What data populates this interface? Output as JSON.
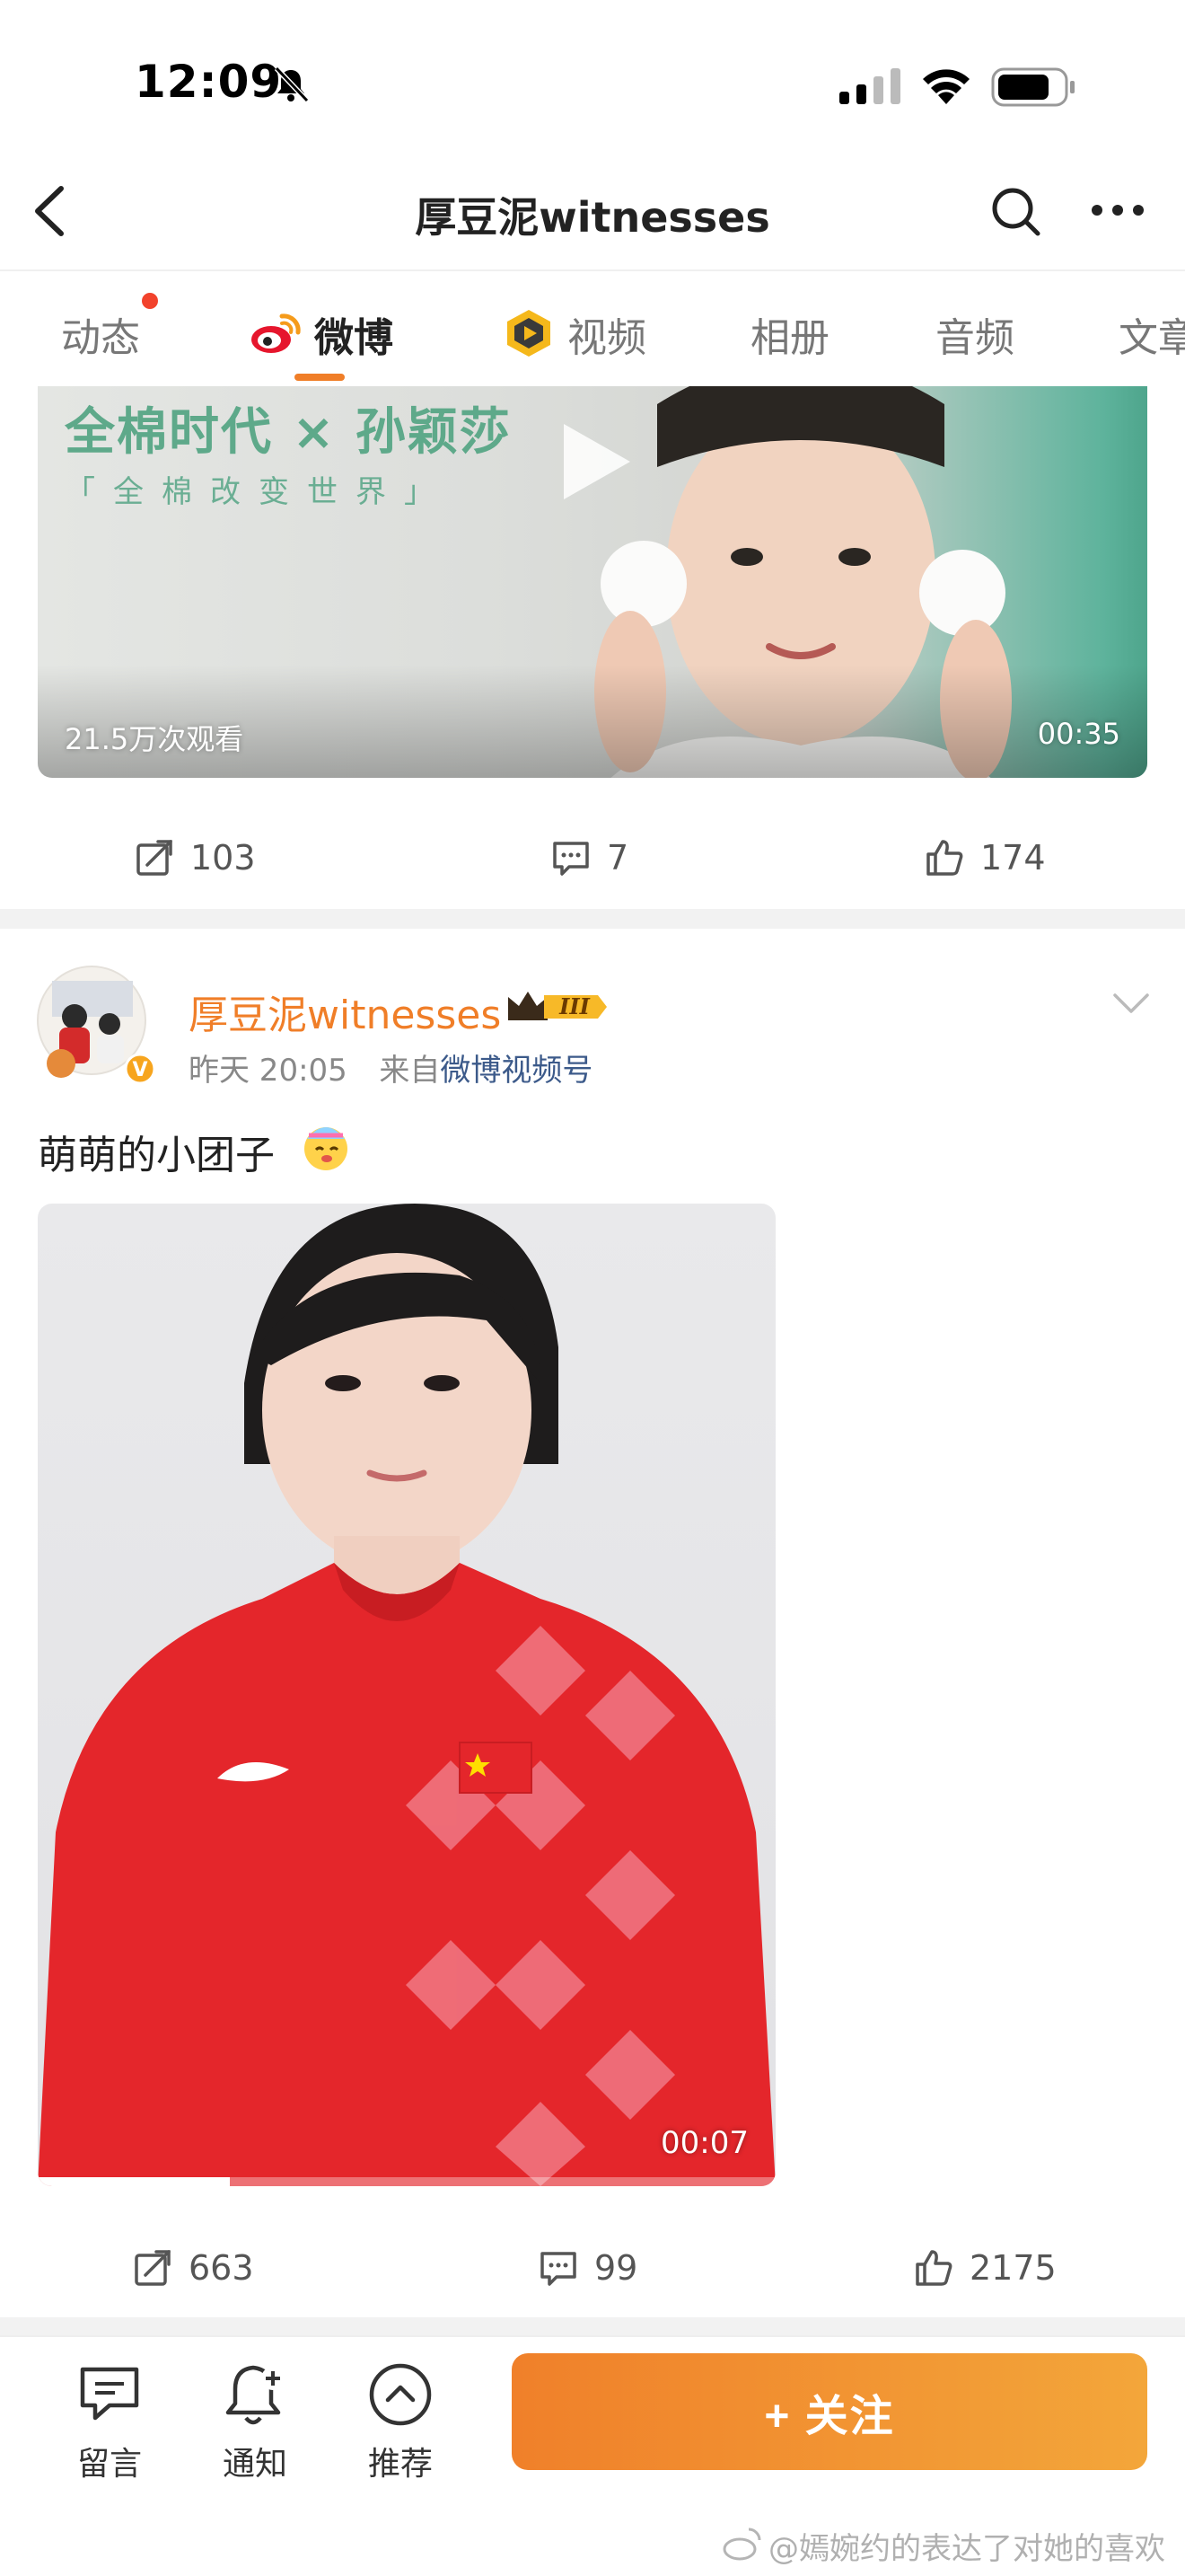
{
  "status_bar": {
    "time": "12:09"
  },
  "nav": {
    "title": "厚豆泥witnesses"
  },
  "tabs": [
    {
      "label": "动态"
    },
    {
      "label": "微博"
    },
    {
      "label": "视频"
    },
    {
      "label": "相册"
    },
    {
      "label": "音频"
    },
    {
      "label": "文章"
    }
  ],
  "post1": {
    "video": {
      "headline": "全棉时代 × 孙颖莎",
      "subline": "「全棉改变世界」",
      "views": "21.5万次观看",
      "duration": "00:35"
    },
    "actions": {
      "repost": "103",
      "comment": "7",
      "like": "174"
    }
  },
  "post2": {
    "author": "厚豆泥witnesses",
    "badge": "III",
    "time": "昨天 20:05",
    "from_prefix": "来自",
    "source": "微博视频号",
    "text": "萌萌的小团子",
    "video": {
      "duration": "00:07",
      "progress_fraction": 0.26
    },
    "actions": {
      "repost": "663",
      "comment": "99",
      "like": "2175"
    }
  },
  "bottom_bar": {
    "message": "留言",
    "notify": "通知",
    "recommend": "推荐",
    "follow": "+ 关注"
  },
  "watermark": "@嫣婉约的表达了对她的喜欢",
  "colors": {
    "accent": "#f07e28",
    "link": "#3c5a8a",
    "red_dot": "#f2432c"
  }
}
